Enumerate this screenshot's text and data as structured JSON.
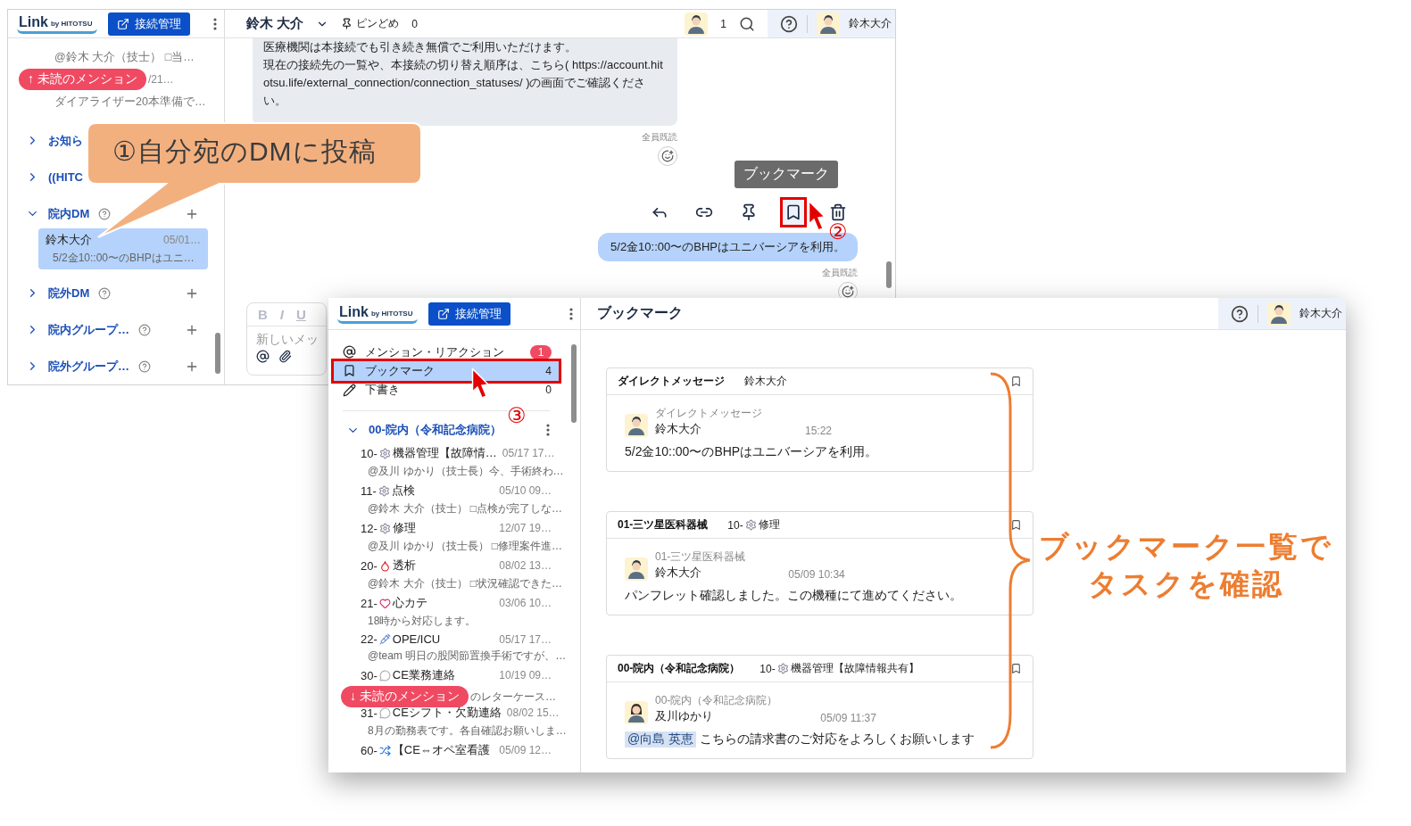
{
  "back_window": {
    "logo": {
      "name": "Link",
      "by": "by HITOTSU"
    },
    "connect_button": "接続管理",
    "sidebar": {
      "rows": [
        {
          "preview": "@鈴木 大介（技士） □当…"
        },
        {
          "badge": "↑ 未読のメンション",
          "time": "/21…",
          "preview": "ダイアライザー20本準備で…"
        }
      ],
      "groups": [
        {
          "label": "お知ら",
          "expanded": false,
          "help": false,
          "add": false
        },
        {
          "label": "((HITC",
          "expanded": false,
          "help": false,
          "add": false
        },
        {
          "label": "院内DM",
          "expanded": true,
          "help": true,
          "add": true,
          "children": [
            {
              "name": "鈴木大介",
              "time": "05/01…",
              "preview": "5/2金10::00〜のBHPはユニ…",
              "selected": true
            }
          ]
        },
        {
          "label": "院外DM",
          "expanded": false,
          "help": true,
          "add": true
        },
        {
          "label": "院内グループ…",
          "expanded": false,
          "help": true,
          "add": true
        },
        {
          "label": "院外グループ…",
          "expanded": false,
          "help": true,
          "add": true
        }
      ]
    },
    "chat": {
      "title": "鈴木 大介",
      "pins_label": "ピンどめ",
      "pins_count": "0",
      "members": "1",
      "user": "鈴木大介",
      "received": {
        "paragraphs": [
          "医療機関は本接続でも引き続き無償でご利用いただけます。",
          "現在の接続先の一覧や、本接続の切り替え順序は、こちら( https://account.hitotsu.life/external_connection/connection_statuses/ )の画面でご確認ください。"
        ],
        "read": "全員既読"
      },
      "tooltip": "ブックマーク",
      "actions": [
        {
          "kind": "reply",
          "highlighted": false
        },
        {
          "kind": "link",
          "highlighted": false
        },
        {
          "kind": "pin",
          "highlighted": false
        },
        {
          "kind": "bookmark",
          "highlighted": true
        },
        {
          "kind": "trash",
          "highlighted": false
        }
      ],
      "sent": {
        "text": "5/2金10::00〜のBHPはユニバーシアを利用。",
        "read": "全員既読"
      },
      "compose": {
        "format": [
          "B",
          "I",
          "U"
        ],
        "placeholder": "新しいメッ"
      }
    }
  },
  "front_window": {
    "logo": {
      "name": "Link",
      "by": "by HITOTSU"
    },
    "connect_button": "接続管理",
    "title": "ブックマーク",
    "user": "鈴木大介",
    "nav": [
      {
        "kind": "mention",
        "label": "メンション・リアクション",
        "count": "1",
        "selected": false,
        "highlighted": false
      },
      {
        "kind": "bookmark",
        "label": "ブックマーク",
        "count": "4",
        "selected": true,
        "highlighted": true
      },
      {
        "kind": "draft",
        "label": "下書き",
        "count": "0",
        "selected": false,
        "highlighted": false
      }
    ],
    "section": {
      "label": "00-院内（令和記念病院）",
      "expanded": true,
      "channels": [
        {
          "number": "10-",
          "kind": "gear",
          "name": "機器管理【故障情…",
          "time": "05/17 17…",
          "preview": "@及川 ゆかり（技士長）今、手術終わ…"
        },
        {
          "number": "11-",
          "kind": "gear",
          "name": "点検",
          "time": "05/10 09…",
          "preview": "@鈴木 大介（技士） □点検が完了しな…"
        },
        {
          "number": "12-",
          "kind": "gear",
          "name": "修理",
          "time": "12/07 19…",
          "preview": "@及川 ゆかり（技士長） □修理案件進…"
        },
        {
          "number": "20-",
          "kind": "drop",
          "name": "透析",
          "time": "08/02 13…",
          "preview": "@鈴木 大介（技士） □状況確認できた…"
        },
        {
          "number": "21-",
          "kind": "heart",
          "name": "心カテ",
          "time": "03/06 10…",
          "preview": "18時から対応します。"
        },
        {
          "number": "22-",
          "kind": "syringe",
          "name": "OPE/ICU",
          "time": "05/17 17…",
          "preview": "@team 明日の股関節置換手術ですが、…"
        },
        {
          "number": "30-",
          "kind": "bubble",
          "name": "CE業務連絡",
          "time": "10/19 09…",
          "badge": "↓ 未読のメンション",
          "preview": "のレターケース…"
        },
        {
          "number": "31-",
          "kind": "bubble",
          "name": "CEシフト・欠勤連絡",
          "time": "08/02 15…",
          "preview": "8月の勤務表です。各自確認お願いしま…"
        },
        {
          "number": "60-",
          "kind": "shuffle",
          "name": "【CE⇔オペ室看護",
          "time": "05/09 12…"
        }
      ]
    },
    "bookmarks": [
      {
        "channel": "ダイレクトメッセージ",
        "topic": {
          "name": "鈴木大介"
        },
        "source": "ダイレクトメッセージ",
        "author": "鈴木大介",
        "time": "15:22",
        "text": "5/2金10::00〜のBHPはユニバーシアを利用。"
      },
      {
        "channel": "01-三ツ星医科器械",
        "topic": {
          "number": "10-",
          "kind": "gear",
          "name": "修理"
        },
        "source": "01-三ツ星医科器械",
        "author": "鈴木大介",
        "time": "05/09 10:34",
        "text": "パンフレット確認しました。この機種にて進めてください。"
      },
      {
        "channel": "00-院内（令和記念病院）",
        "topic": {
          "number": "10-",
          "kind": "gear",
          "name": "機器管理【故障情報共有】"
        },
        "source": "00-院内（令和記念病院）",
        "author": "及川ゆかり",
        "time": "05/09 11:37",
        "mention": "@向島 英恵",
        "text": "こちらの請求書のご対応をよろしくお願いします"
      }
    ]
  },
  "annotations": {
    "callout": "①自分宛のDMに投稿",
    "step_2": "②",
    "step_3": "③",
    "summary": [
      "ブックマーク一覧で",
      "タスクを確認"
    ]
  }
}
